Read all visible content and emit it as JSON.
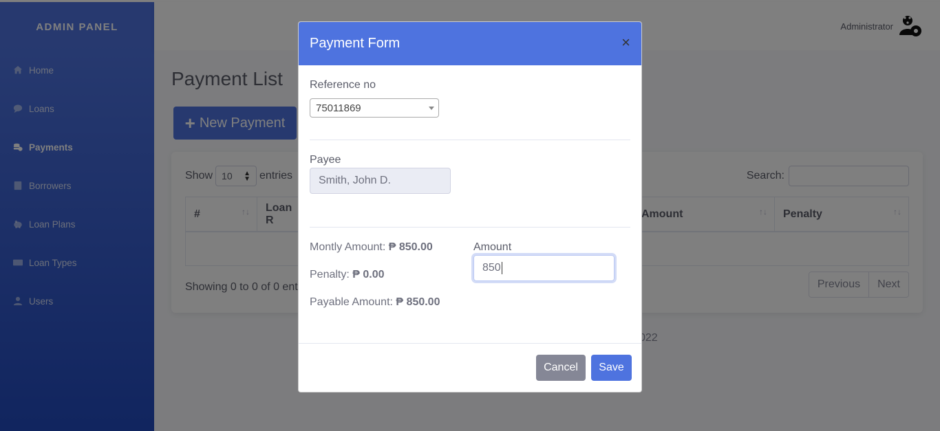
{
  "sidebar": {
    "brand": "ADMIN PANEL",
    "items": [
      {
        "label": "Home",
        "icon": "home-icon"
      },
      {
        "label": "Loans",
        "icon": "comment-icon"
      },
      {
        "label": "Payments",
        "icon": "coins-icon",
        "active": true
      },
      {
        "label": "Borrowers",
        "icon": "book-icon"
      },
      {
        "label": "Loan Plans",
        "icon": "piggy-bank-icon"
      },
      {
        "label": "Loan Types",
        "icon": "card-icon"
      },
      {
        "label": "Users",
        "icon": "user-icon"
      }
    ]
  },
  "topbar": {
    "user_name": "Administrator",
    "avatar_icon": "user-gear-icon"
  },
  "main": {
    "page_title": "Payment List",
    "new_button": "New Payment",
    "show_label": "Show",
    "entries_value": "10",
    "entries_label": "entries",
    "search_label": "Search:",
    "columns": [
      "#",
      "Loan R",
      "Amount",
      "Penalty"
    ],
    "info": "Showing 0 to 0 of 0 ent",
    "pager": {
      "previous": "Previous",
      "next": "Next"
    },
    "footer_text": "022"
  },
  "modal": {
    "title": "Payment Form",
    "close_glyph": "×",
    "reference_label": "Reference no",
    "reference_value": "75011869",
    "payee_label": "Payee",
    "payee_value": "Smith, John D.",
    "monthly_label": "Montly Amount:",
    "monthly_value": "₱ 850.00",
    "penalty_label": "Penalty:",
    "penalty_value": "₱ 0.00",
    "payable_label": "Payable Amount:",
    "payable_value": "₱ 850.00",
    "amount_label": "Amount",
    "amount_value": "850",
    "cancel_label": "Cancel",
    "save_label": "Save"
  },
  "colors": {
    "primary": "#4e73df",
    "secondary": "#858796",
    "backdrop": "rgba(0,0,0,0.5)"
  }
}
